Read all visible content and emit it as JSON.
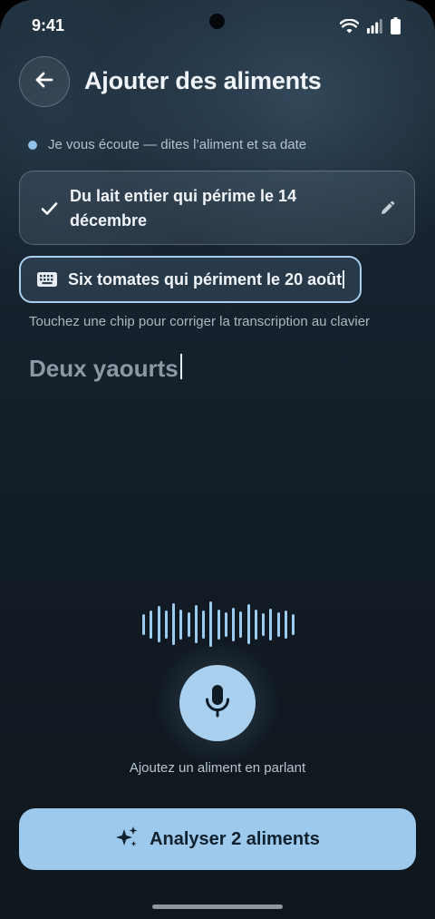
{
  "status_bar": {
    "time": "9:41",
    "icons": [
      "wifi-icon",
      "signal-icon",
      "battery-icon"
    ]
  },
  "header": {
    "back_icon": "arrow-left-icon",
    "title": "Ajouter des aliments"
  },
  "listening": {
    "text": "Je vous écoute — dites l’aliment et sa date",
    "dot_color": "#8fc3ec"
  },
  "chips": {
    "confirmed": {
      "text": "Du lait entier qui périme le 14 décembre",
      "status_icon": "check-icon",
      "action_icon": "pencil-icon"
    },
    "editing": {
      "text": "Six tomates qui périment le 20 août",
      "icon": "keyboard-icon"
    }
  },
  "hint": "Touchez une chip pour corriger la transcription au clavier",
  "live_transcript": "Deux yaourts",
  "waveform": {
    "levels": [
      0.35,
      0.55,
      0.75,
      0.55,
      0.9,
      0.6,
      0.45,
      0.8,
      0.55,
      1.0,
      0.6,
      0.45,
      0.7,
      0.5,
      0.85,
      0.6,
      0.4,
      0.65,
      0.45,
      0.55,
      0.35
    ],
    "color": "#9ccbf0"
  },
  "mic": {
    "icon": "microphone-icon",
    "caption": "Ajoutez un aliment en parlant"
  },
  "primary_action": {
    "icon": "sparkles-icon",
    "label": "Analyser 2 aliments",
    "color": "#9cc9ec"
  }
}
